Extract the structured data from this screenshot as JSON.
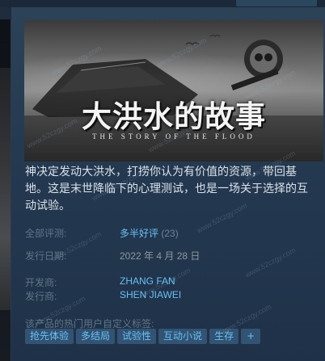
{
  "header": {
    "title_cn": "大洪水的故事",
    "title_en": "THE STORY OF THE FLOOD"
  },
  "description": "神决定发动大洪水，打捞你认为有价值的资源，带回基地。这是末世降临下的心理测试，也是一场关于选择的互动试验。",
  "reviews": {
    "label": "全部评测:",
    "summary": "多半好评",
    "count": "(23)"
  },
  "release": {
    "label": "发行日期:",
    "date": "2022 年 4 月 28 日"
  },
  "developer": {
    "label": "开发商:",
    "name": "ZHANG FAN"
  },
  "publisher": {
    "label": "发行商:",
    "name": "SHEN JIAWEI"
  },
  "tags": {
    "label": "该产品的热门用户自定义标签:",
    "items": [
      "抢先体验",
      "多结局",
      "试验性",
      "互动小说",
      "生存"
    ],
    "more": "+"
  },
  "watermark": "www.52czgy.com",
  "colors": {
    "link": "#66c0f4",
    "tag_bg": "#325372",
    "panel_bg": "#243a51"
  }
}
